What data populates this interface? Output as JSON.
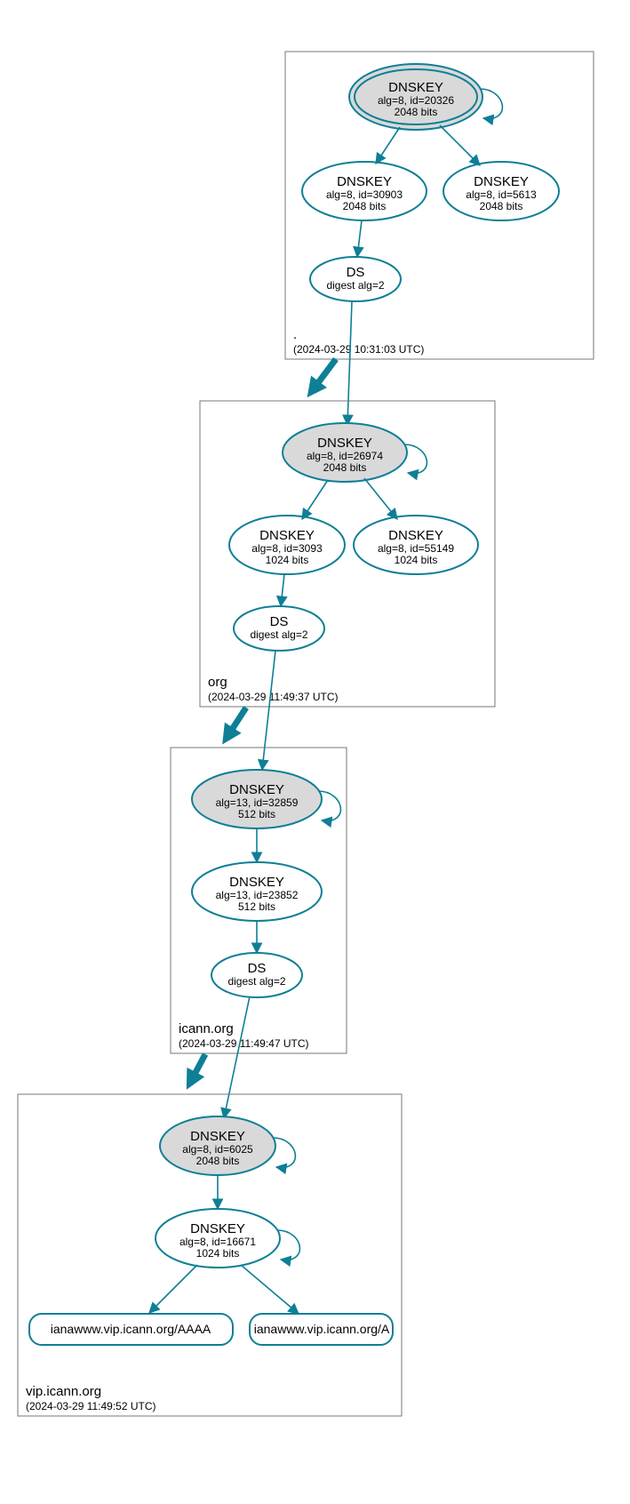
{
  "colors": {
    "stroke": "#0e7f96",
    "ksk_fill": "#d9d9d9"
  },
  "zones": {
    "root": {
      "label": ".",
      "timestamp": "(2024-03-29 10:31:03 UTC)",
      "ksk": {
        "type": "DNSKEY",
        "detail": "alg=8, id=20326",
        "bits": "2048 bits"
      },
      "zsk1": {
        "type": "DNSKEY",
        "detail": "alg=8, id=30903",
        "bits": "2048 bits"
      },
      "zsk2": {
        "type": "DNSKEY",
        "detail": "alg=8, id=5613",
        "bits": "2048 bits"
      },
      "ds": {
        "type": "DS",
        "detail": "digest alg=2"
      }
    },
    "org": {
      "label": "org",
      "timestamp": "(2024-03-29 11:49:37 UTC)",
      "ksk": {
        "type": "DNSKEY",
        "detail": "alg=8, id=26974",
        "bits": "2048 bits"
      },
      "zsk1": {
        "type": "DNSKEY",
        "detail": "alg=8, id=3093",
        "bits": "1024 bits"
      },
      "zsk2": {
        "type": "DNSKEY",
        "detail": "alg=8, id=55149",
        "bits": "1024 bits"
      },
      "ds": {
        "type": "DS",
        "detail": "digest alg=2"
      }
    },
    "icann": {
      "label": "icann.org",
      "timestamp": "(2024-03-29 11:49:47 UTC)",
      "ksk": {
        "type": "DNSKEY",
        "detail": "alg=13, id=32859",
        "bits": "512 bits"
      },
      "zsk": {
        "type": "DNSKEY",
        "detail": "alg=13, id=23852",
        "bits": "512 bits"
      },
      "ds": {
        "type": "DS",
        "detail": "digest alg=2"
      }
    },
    "vip": {
      "label": "vip.icann.org",
      "timestamp": "(2024-03-29 11:49:52 UTC)",
      "ksk": {
        "type": "DNSKEY",
        "detail": "alg=8, id=6025",
        "bits": "2048 bits"
      },
      "zsk": {
        "type": "DNSKEY",
        "detail": "alg=8, id=16671",
        "bits": "1024 bits"
      },
      "rr1": "ianawww.vip.icann.org/AAAA",
      "rr2": "ianawww.vip.icann.org/A"
    }
  }
}
